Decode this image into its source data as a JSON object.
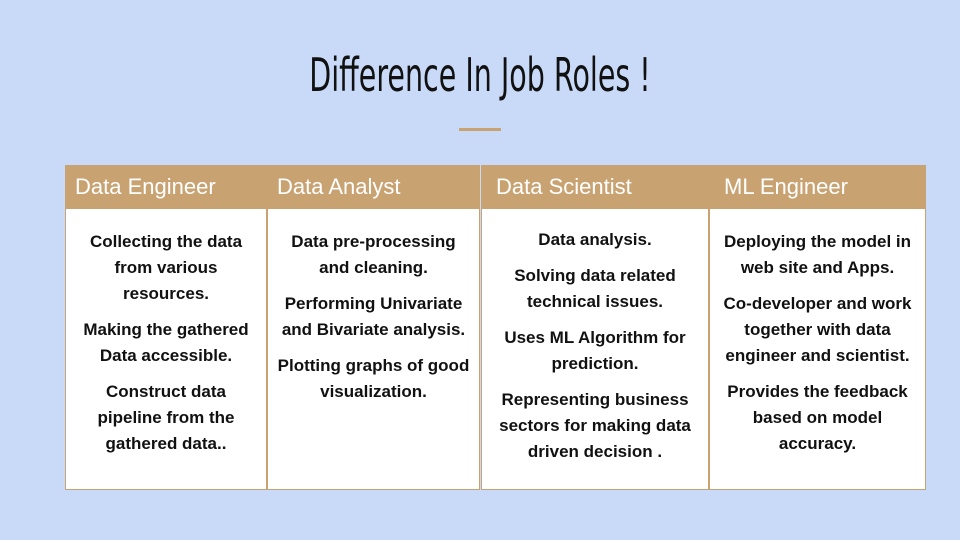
{
  "title": "Difference In Job Roles !",
  "columns": [
    {
      "header": "Data Engineer",
      "items": [
        "Collecting the data from various resources.",
        "Making the gathered Data accessible.",
        "Construct data pipeline from the gathered data.."
      ]
    },
    {
      "header": "Data Analyst",
      "items": [
        "Data pre-processing and cleaning.",
        "Performing Univariate and Bivariate analysis.",
        "Plotting graphs of good visualization."
      ]
    },
    {
      "header": "Data Scientist",
      "items": [
        "Data analysis.",
        "Solving data related technical issues.",
        "Uses ML Algorithm for prediction.",
        "Representing business sectors for making data driven decision ."
      ]
    },
    {
      "header": "ML Engineer",
      "items": [
        "Deploying the model in web site and Apps.",
        "Co-developer and work together with data engineer and scientist.",
        "Provides the feedback based on model accuracy."
      ]
    }
  ],
  "colors": {
    "background": "#c9daf8",
    "header": "#c9a272",
    "accent": "#c9a272"
  }
}
